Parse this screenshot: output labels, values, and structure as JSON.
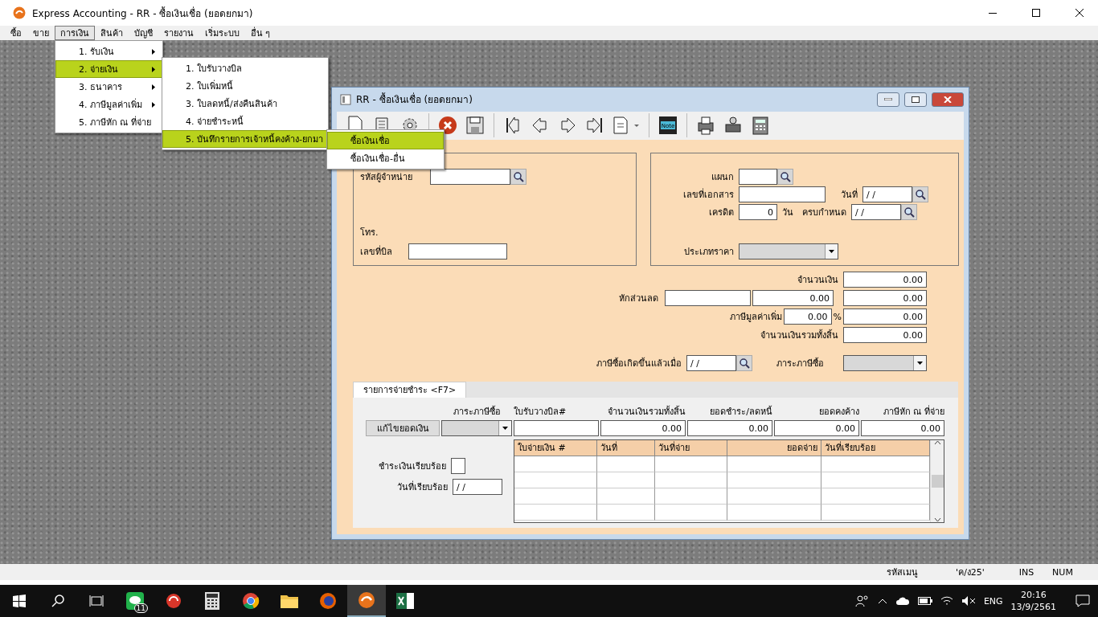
{
  "window": {
    "title": "Express Accounting - RR - ซื้อเงินเชื่อ (ยอดยกมา)"
  },
  "menu_bar": [
    {
      "label": "ซื้อ",
      "selected": false
    },
    {
      "label": "ขาย",
      "selected": false
    },
    {
      "label": "การเงิน",
      "selected": true
    },
    {
      "label": "สินค้า",
      "selected": false
    },
    {
      "label": "บัญชี",
      "selected": false
    },
    {
      "label": "รายงาน",
      "selected": false
    },
    {
      "label": "เริ่มระบบ",
      "selected": false
    },
    {
      "label": "อื่น ๆ",
      "selected": false
    }
  ],
  "menus": [
    {
      "items": [
        {
          "label": "1. รับเงิน",
          "selected": false,
          "submenu": true
        },
        {
          "label": "2. จ่ายเงิน",
          "selected": true,
          "submenu": true
        },
        {
          "label": "3. ธนาคาร",
          "selected": false,
          "submenu": true
        },
        {
          "label": "4. ภาษีมูลค่าเพิ่ม",
          "selected": false,
          "submenu": true
        },
        {
          "label": "5. ภาษีหัก ณ ที่จ่าย",
          "selected": false,
          "submenu": false
        }
      ]
    },
    {
      "items": [
        {
          "label": "1. ใบรับวางบิล",
          "selected": false,
          "submenu": false
        },
        {
          "label": "2. ใบเพิ่มหนี้",
          "selected": false,
          "submenu": false
        },
        {
          "label": "3. ใบลดหนี้/ส่งคืนสินค้า",
          "selected": false,
          "submenu": false
        },
        {
          "label": "4. จ่ายชำระหนี้",
          "selected": false,
          "submenu": false
        },
        {
          "label": "5. บันทึกรายการเจ้าหนี้คงค้าง-ยกมา",
          "selected": true,
          "submenu": true
        }
      ]
    },
    {
      "items": [
        {
          "label": "ซื้อเงินเชื่อ",
          "selected": true,
          "submenu": false
        },
        {
          "label": "ซื้อเงินเชื่อ-อื่น",
          "selected": false,
          "submenu": false
        }
      ]
    }
  ],
  "child_window": {
    "title": "RR - ซื้อเงินเชื่อ (ยอดยกมา)",
    "note_label": "Note"
  },
  "header_left": {
    "supplier_label": "รหัสผู้จำหน่าย",
    "phone_label": "โทร.",
    "bill_label": "เลขที่บิล"
  },
  "header_right": {
    "department_label": "แผนก",
    "doc_no_label": "เลขที่เอกสาร",
    "date_label": "วันที่",
    "date_value": "/ /",
    "credit_label": "เครดิต",
    "credit_value": "0",
    "credit_unit": "วัน",
    "due_label": "ครบกำหนด",
    "due_value": "/ /",
    "price_type_label": "ประเภทราคา"
  },
  "totals": {
    "amount_label": "จำนวนเงิน",
    "amount": "0.00",
    "discount_label": "หักส่วนลด",
    "discount_value": "0.00",
    "discount_amount": "0.00",
    "vat_label": "ภาษีมูลค่าเพิ่ม",
    "vat_rate": "0.00",
    "vat_unit": "%",
    "vat_amount": "0.00",
    "total_label": "จำนวนเงินรวมทั้งสิ้น",
    "total": "0.00",
    "tax_date_label": "ภาษีซื้อเกิดขึ้นแล้วเมื่อ",
    "tax_date": "/ /",
    "tax_burden_label": "ภาระภาษีซื้อ"
  },
  "payment_tab": {
    "tab": {
      "label": "รายการจ่ายชำระ <F7>",
      "selected": true
    },
    "headers": [
      "ภาระภาษีซื้อ",
      "ใบรับวางบิล#",
      "จำนวนเงินรวมทั้งสิ้น",
      "ยอดชำระ/ลดหนี้",
      "ยอดคงค้าง",
      "ภาษีหัก ณ ที่จ่าย"
    ],
    "values": [
      "0.00",
      "0.00",
      "0.00",
      "0.00"
    ],
    "edit_button": "แก้ไขยอดเงิน",
    "paid_label": "ชำระเงินเรียบร้อย",
    "paid_checked": false,
    "paid_date_label": "วันที่เรียบร้อย",
    "paid_date": "/ /",
    "columns": [
      "ใบจ่ายเงิน #",
      "วันที่",
      "วันที่จ่าย",
      "ยอดจ่าย",
      "วันที่เรียบร้อย"
    ]
  },
  "status_bar": [
    "รหัสเมนู",
    "'ค/ง25'",
    "INS",
    "NUM"
  ],
  "taskbar": {
    "badge": "11",
    "language": "ENG",
    "time": "20:16",
    "date": "13/9/2561"
  }
}
